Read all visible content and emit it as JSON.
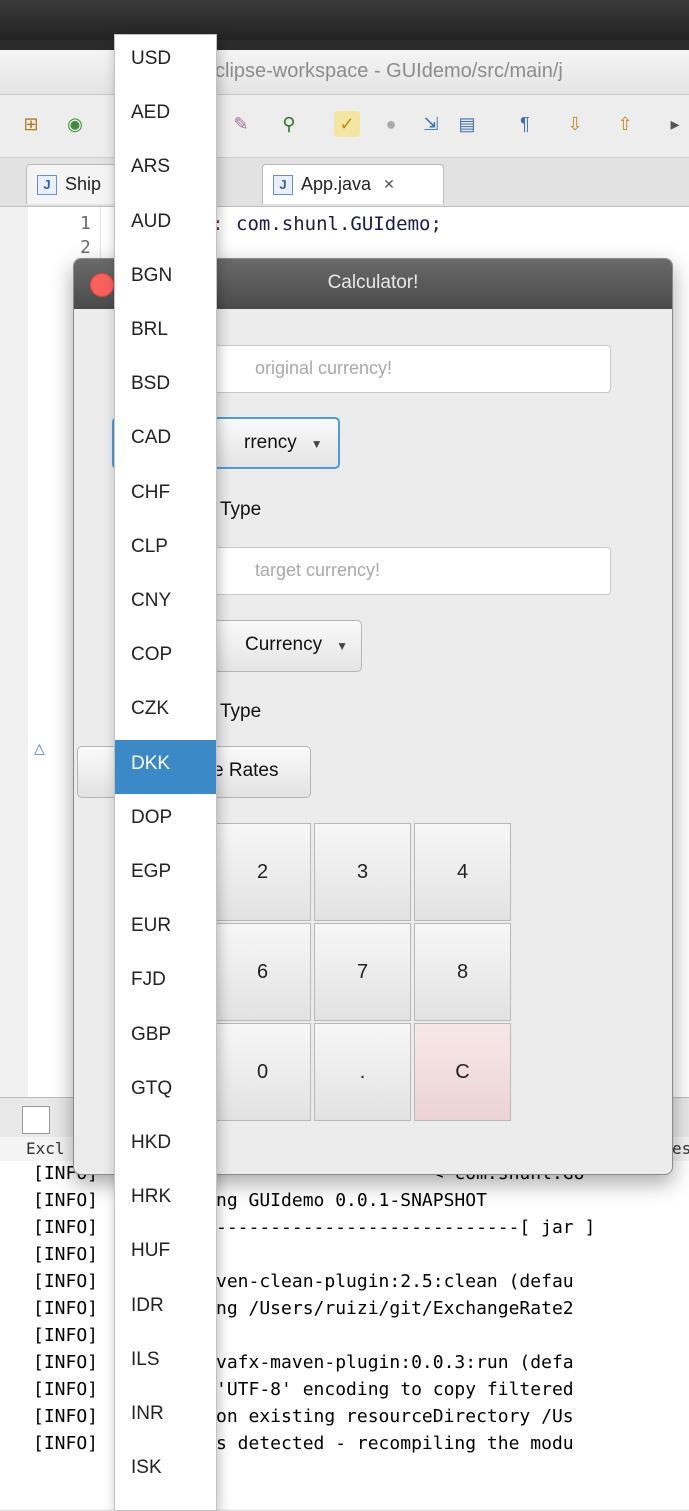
{
  "eclipse": {
    "window_title": "clipse-workspace - GUIdemo/src/main/j",
    "tabs": [
      {
        "label": "Ship"
      },
      {
        "label": "App.java",
        "close": "✕"
      }
    ],
    "line_numbers": [
      "1",
      "2"
    ],
    "code_line_1": "com.shunl.GUIdemo;",
    "console_header": "Excl",
    "console_header_right": "es",
    "console_lines": [
      {
        "prefix": "[INFO]",
        "text": "--------------------< com.shunl:GU"
      },
      {
        "prefix": "[INFO]",
        "text": "ng GUIdemo 0.0.1-SNAPSHOT"
      },
      {
        "prefix": "[INFO]",
        "text": "----------------------------[ jar ]"
      },
      {
        "prefix": "[INFO]",
        "text": ""
      },
      {
        "prefix": "[INFO]",
        "text": "ven-clean-plugin:2.5:clean (defau"
      },
      {
        "prefix": "[INFO]",
        "text": "ng /Users/ruizi/git/ExchangeRate2"
      },
      {
        "prefix": "[INFO]",
        "text": ""
      },
      {
        "prefix": "[INFO]",
        "text": "vafx-maven-plugin:0.0.3:run (defa"
      },
      {
        "prefix": "[INFO]",
        "text": "'UTF-8' encoding to copy filtered"
      },
      {
        "prefix": "[INFO]",
        "text": "on existing resourceDirectory /Us"
      },
      {
        "prefix": "[INFO]",
        "text": "s detected - recompiling the modu"
      }
    ]
  },
  "calculator": {
    "title": "Calculator!",
    "original_field_placeholder": "original currency!",
    "original_combo_label": "rrency",
    "original_type_label": "Type",
    "target_field_placeholder": "target currency!",
    "target_combo_label": "Currency",
    "target_type_label": "Type",
    "rates_button_label": "e Rates",
    "keys": [
      "2",
      "3",
      "4",
      "6",
      "7",
      "8",
      "0",
      ".",
      "C"
    ]
  },
  "dropdown": {
    "selected": "DKK",
    "options": [
      "USD",
      "AED",
      "ARS",
      "AUD",
      "BGN",
      "BRL",
      "BSD",
      "CAD",
      "CHF",
      "CLP",
      "CNY",
      "COP",
      "CZK",
      "DKK",
      "DOP",
      "EGP",
      "EUR",
      "FJD",
      "GBP",
      "GTQ",
      "HKD",
      "HRK",
      "HUF",
      "IDR",
      "ILS",
      "INR",
      "ISK"
    ]
  },
  "colors": {
    "selection": "#3b8ac7",
    "close_button": "#fc605c",
    "focus_ring": "#4f9bd8"
  }
}
